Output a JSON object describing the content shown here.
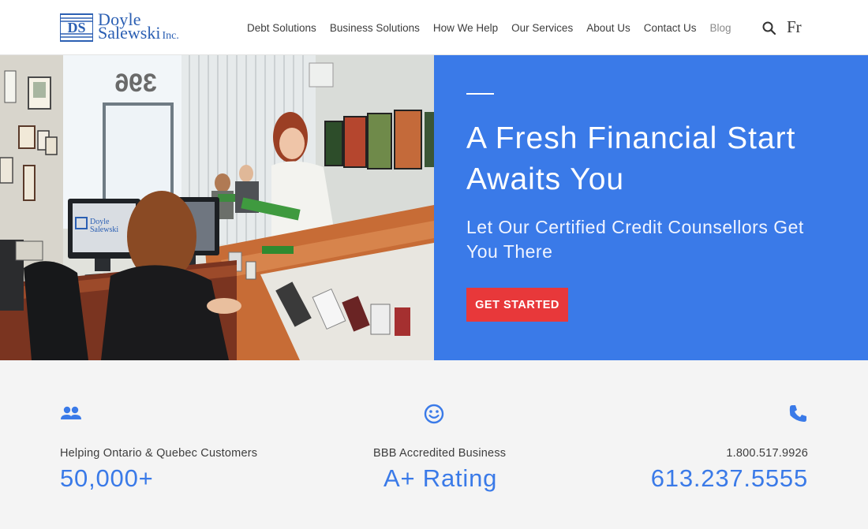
{
  "brand": {
    "line1": "Doyle",
    "line2": "Salewski",
    "suffix": "Inc.",
    "mark": "DS",
    "color": "#2b5fb3"
  },
  "nav": {
    "items": [
      {
        "label": "Debt Solutions"
      },
      {
        "label": "Business Solutions"
      },
      {
        "label": "How We Help"
      },
      {
        "label": "Our Services"
      },
      {
        "label": "About Us"
      },
      {
        "label": "Contact Us"
      },
      {
        "label": "Blog"
      }
    ],
    "search_icon": "search-icon",
    "language_label": "Fr"
  },
  "hero": {
    "title": "A Fresh Financial Start Awaits You",
    "subtitle": "Let Our Certified Credit Counsellors Get You There",
    "cta_label": "GET STARTED",
    "panel_color": "#3a7ae8",
    "cta_color": "#e8383a",
    "photo": {
      "office_number": "396",
      "monitor_logo_line1": "Doyle",
      "monitor_logo_line2": "Salewski"
    }
  },
  "stats": [
    {
      "icon": "people-icon",
      "label": "Helping Ontario & Quebec Customers",
      "value": "50,000+"
    },
    {
      "icon": "smiley-icon",
      "label": "BBB Accredited Business",
      "value": "A+ Rating"
    },
    {
      "icon": "phone-icon",
      "label": "1.800.517.9926",
      "value": "613.237.5555"
    }
  ]
}
